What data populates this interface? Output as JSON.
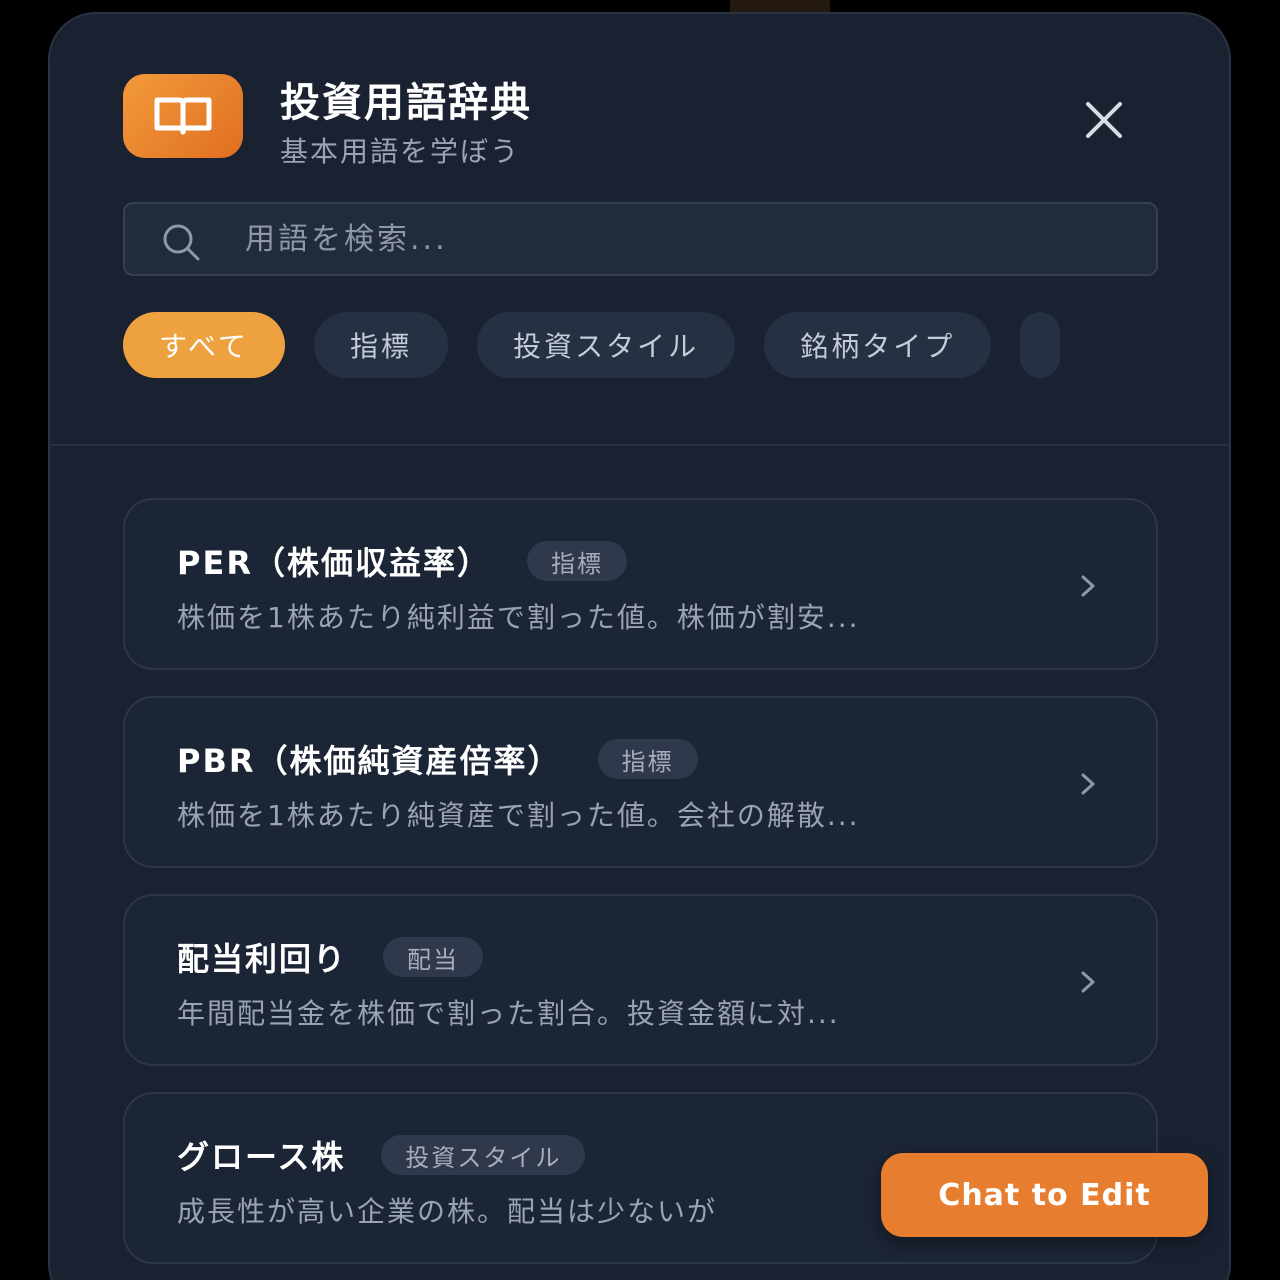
{
  "header": {
    "title": "投資用語辞典",
    "subtitle": "基本用語を学ぼう",
    "app_icon": "book-icon",
    "close_icon": "close-icon"
  },
  "search": {
    "placeholder": "用語を検索...",
    "value": "",
    "icon": "search-icon"
  },
  "categories": [
    {
      "label": "すべて",
      "active": true
    },
    {
      "label": "指標",
      "active": false
    },
    {
      "label": "投資スタイル",
      "active": false
    },
    {
      "label": "銘柄タイプ",
      "active": false
    }
  ],
  "terms": [
    {
      "title": "PER（株価収益率）",
      "tag": "指標",
      "desc": "株価を1株あたり純利益で割った値。株価が割安..."
    },
    {
      "title": "PBR（株価純資産倍率）",
      "tag": "指標",
      "desc": "株価を1株あたり純資産で割った値。会社の解散..."
    },
    {
      "title": "配当利回り",
      "tag": "配当",
      "desc": "年間配当金を株価で割った割合。投資金額に対..."
    },
    {
      "title": "グロース株",
      "tag": "投資スタイル",
      "desc": "成長性が高い企業の株。配当は少ないが"
    }
  ],
  "chat_button": {
    "label": "Chat to Edit"
  },
  "colors": {
    "accent": "#eea13f",
    "panel_bg": "#1a2232",
    "chat_button": "#e77d2e"
  }
}
